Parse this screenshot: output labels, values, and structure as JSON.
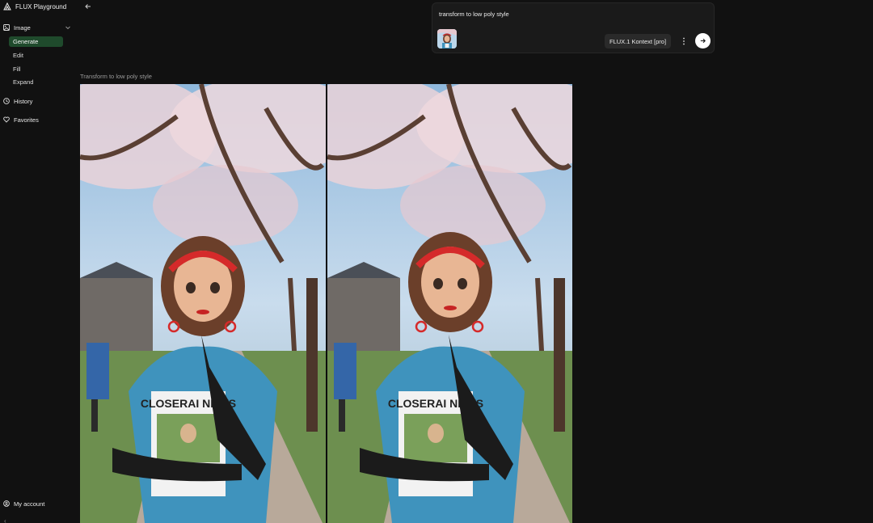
{
  "app": {
    "title": "FLUX Playground"
  },
  "sidebar": {
    "image_section": {
      "label": "Image",
      "icon": "image-icon"
    },
    "sub_items": [
      {
        "label": "Generate",
        "active": true
      },
      {
        "label": "Edit",
        "active": false
      },
      {
        "label": "Fill",
        "active": false
      },
      {
        "label": "Expand",
        "active": false
      }
    ],
    "history": {
      "label": "History",
      "icon": "clock-icon"
    },
    "favorites": {
      "label": "Favorites",
      "icon": "heart-icon"
    },
    "account": {
      "label": "My account",
      "icon": "user-circle-icon"
    }
  },
  "prompt": {
    "text": "transform to low poly style",
    "model_label": "FLUX.1 Kontext [pro]"
  },
  "result": {
    "caption": "Transform to low poly style",
    "images": [
      {
        "newspaper_text": "CLOSERAI NEWS"
      },
      {
        "newspaper_text": "CLOSERAI NEWS"
      }
    ]
  },
  "colors": {
    "background": "#111111",
    "active_nav": "#1f4a2c",
    "panel": "#1a1a1a"
  }
}
